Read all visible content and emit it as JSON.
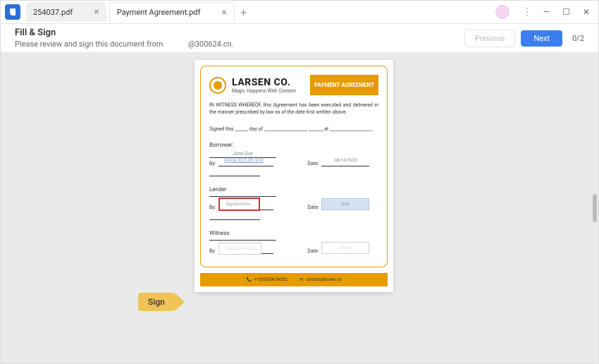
{
  "tabs": [
    {
      "label": "254037.pdf",
      "active": false
    },
    {
      "label": "Payment Agreement.pdf",
      "active": true
    }
  ],
  "toolbar": {
    "title": "Fill & Sign",
    "subtitle_prefix": "Please review and sign this document from",
    "subtitle_suffix": "@300624.cn.",
    "previous_label": "Previous",
    "next_label": "Next",
    "page_count": "0/2"
  },
  "sign_arrow": {
    "label": "Sign"
  },
  "document": {
    "company_name": "LARSEN CO.",
    "company_tagline": "Magic Happens With Content",
    "badge": "PAYMENT AGREEMENT",
    "witness_clause": "IN WITNESS WHEREOF, this Agreement has been executed and delivered in the manner prescribed by law as of the date first written above.",
    "signed_text": "Signed this ______ day of ___________________, ______, at ___________________.",
    "borrower": {
      "label": "Borrower:",
      "name": "Jane Doe",
      "by_label": "By:",
      "signature": "Digital 2023.08.14 ID",
      "date_label": "Date:",
      "date_value": "08/14/2023"
    },
    "lender": {
      "label": "Lender",
      "by_label": "By:",
      "signature_placeholder": "Signature/Ini...",
      "date_label": "Date:",
      "date_placeholder": "Date"
    },
    "witness": {
      "label": "Witness",
      "by_label": "By:",
      "signature_placeholder": "Signature/Initial",
      "date_label": "Date:",
      "date_placeholder": "Date"
    },
    "footer": {
      "phone": "+1(555)34-34322",
      "email": "contact@larsen.co"
    }
  }
}
